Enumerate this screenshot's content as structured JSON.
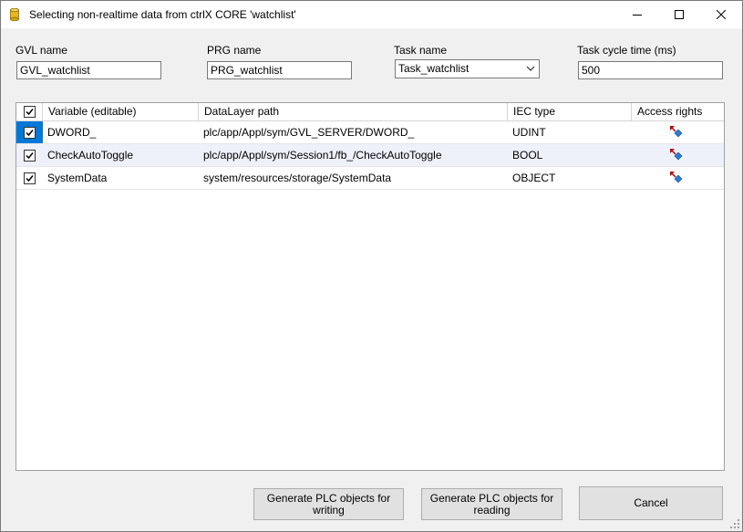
{
  "window": {
    "title": "Selecting non-realtime data from ctrlX CORE 'watchlist'",
    "controls": {
      "minimize": "minimize-icon",
      "maximize": "maximize-icon",
      "close": "close-icon"
    }
  },
  "form": {
    "gvl": {
      "label": "GVL name",
      "value": "GVL_watchlist"
    },
    "prg": {
      "label": "PRG name",
      "value": "PRG_watchlist"
    },
    "task": {
      "label": "Task name",
      "value": "Task_watchlist"
    },
    "cycle": {
      "label": "Task cycle time (ms)",
      "value": "500"
    }
  },
  "grid": {
    "headers": [
      "Variable (editable)",
      "DataLayer path",
      "IEC type",
      "Access rights"
    ],
    "rows": [
      {
        "checked": true,
        "variable": "DWORD_",
        "path": "plc/app/Appl/sym/GVL_SERVER/DWORD_",
        "type": "UDINT",
        "access": "read-write-icon"
      },
      {
        "checked": true,
        "variable": "CheckAutoToggle",
        "path": "plc/app/Appl/sym/Session1/fb_/CheckAutoToggle",
        "type": "BOOL",
        "access": "read-write-icon"
      },
      {
        "checked": true,
        "variable": "SystemData",
        "path": "system/resources/storage/SystemData",
        "type": "OBJECT",
        "access": "read-write-icon"
      }
    ]
  },
  "buttons": {
    "write": "Generate PLC objects for writing",
    "read": "Generate PLC objects for reading",
    "cancel": "Cancel"
  },
  "colors": {
    "selection": "#0078d7",
    "alt_row": "#eef0fa",
    "button_face": "#e1e1e1"
  }
}
